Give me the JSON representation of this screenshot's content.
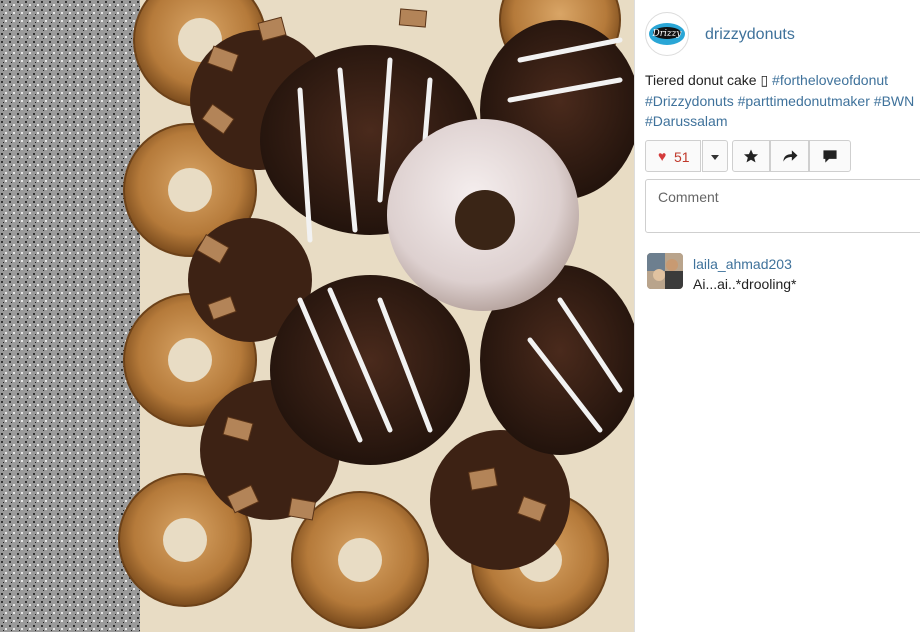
{
  "post": {
    "username": "drizzydonuts",
    "avatar_text": "Drizzy",
    "caption_text": "Tiered donut cake ▯ ",
    "hashtags": [
      "#fortheloveofdonut",
      "#Drizzydonuts",
      "#parttimedonutmaker",
      "#BWN",
      "#Darussalam"
    ],
    "photo_alt": "donut-photo"
  },
  "actions": {
    "like_count": "51",
    "icons": [
      "heart-icon",
      "caret-down-icon",
      "star-icon",
      "share-arrow-icon",
      "speech-bubble-icon"
    ]
  },
  "comment_input": {
    "placeholder": "Comment"
  },
  "comments": [
    {
      "user": "laila_ahmad203",
      "text": "Ai...ai..*drooling*"
    }
  ],
  "colors": {
    "link": "#3f729b",
    "like": "#d43a3a"
  }
}
